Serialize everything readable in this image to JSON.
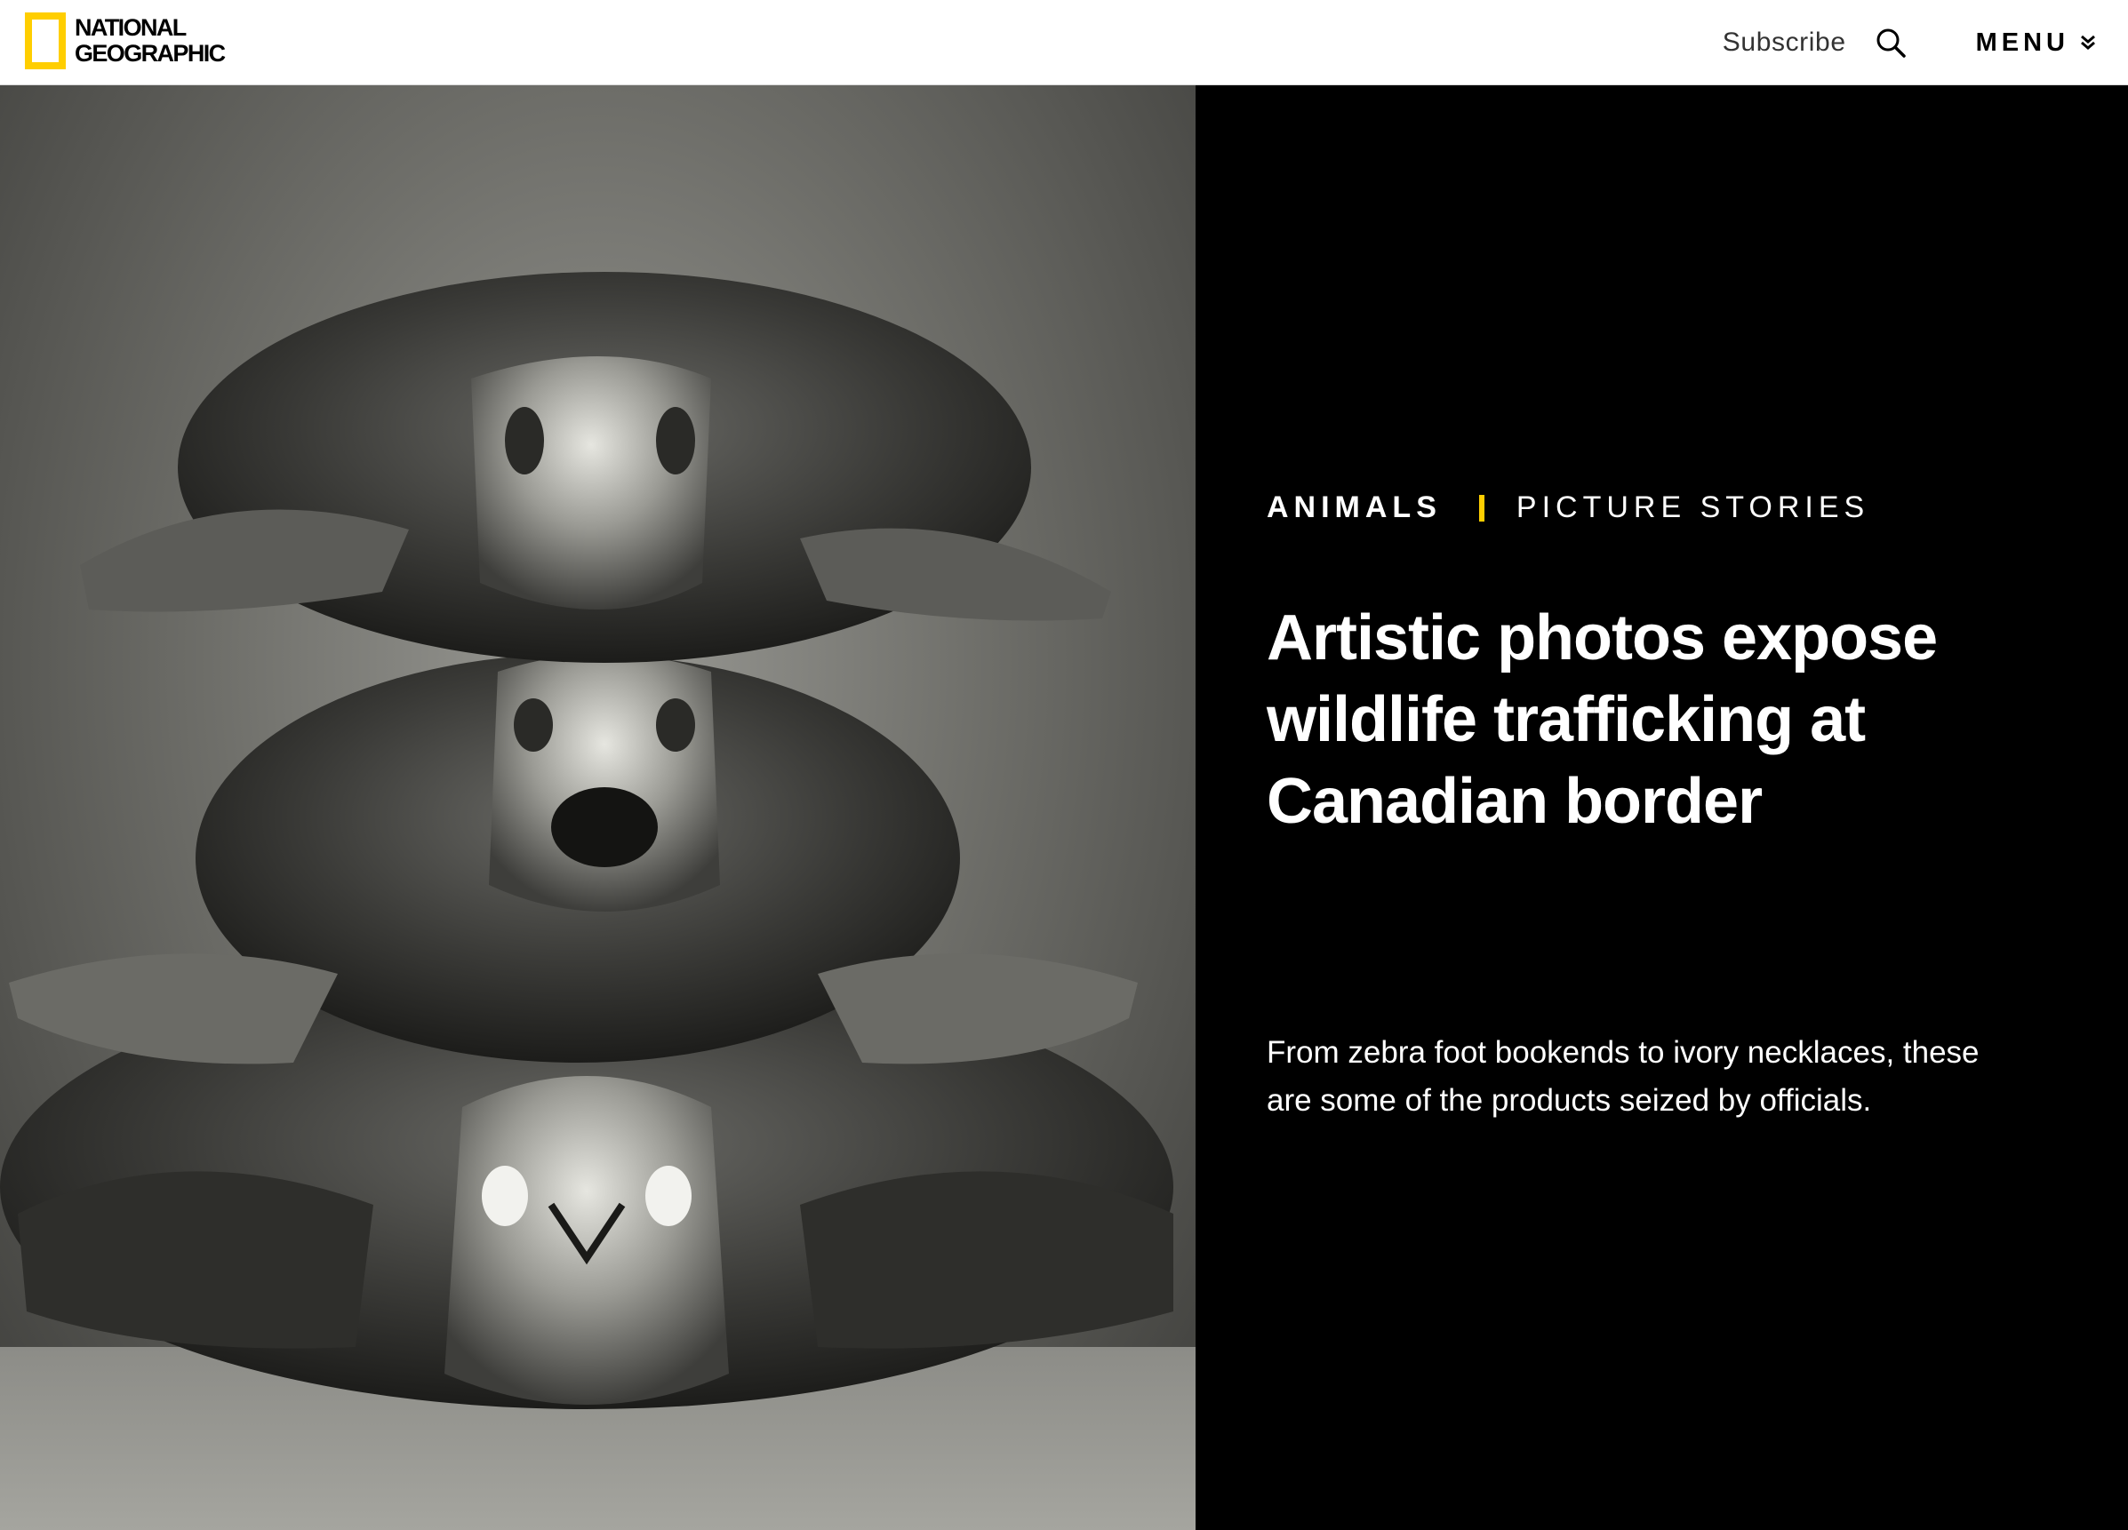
{
  "header": {
    "logo": {
      "line1": "NATIONAL",
      "line2": "GEOGRAPHIC",
      "accent_color": "#ffce00"
    },
    "subscribe_label": "Subscribe",
    "search_icon": "search-icon",
    "menu_label": "MENU",
    "menu_icon": "double-chevron-down-icon"
  },
  "hero": {
    "photo_alt": "Three sea turtles stacked on top of one another, black and white photograph",
    "category": "ANIMALS",
    "subcategory": "PICTURE STORIES",
    "divider_color": "#ffce00",
    "headline": "Artistic photos expose wildlife trafficking at Canadian border",
    "dek": "From zebra foot bookends to ivory necklaces, these are some of the products seized by officials."
  }
}
